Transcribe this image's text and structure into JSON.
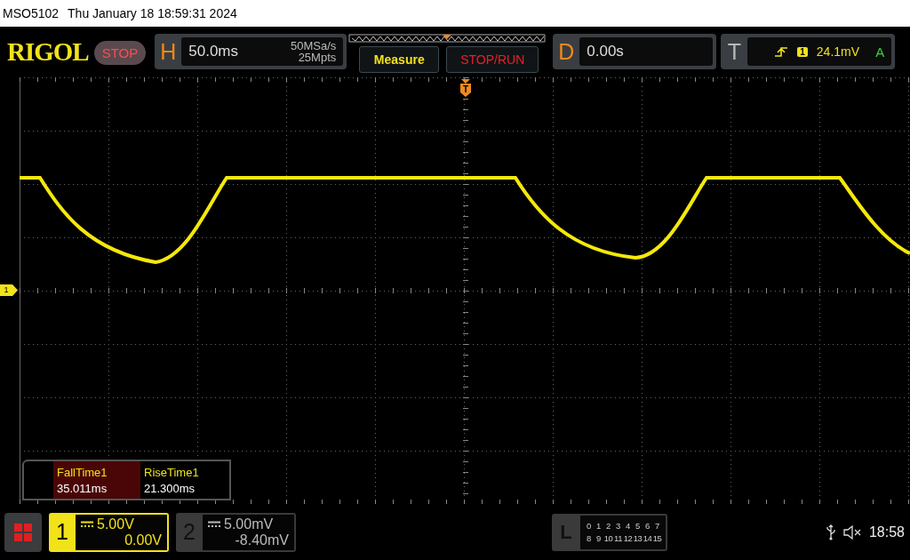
{
  "title_bar": {
    "model": "MSO5102",
    "datetime": "Thu January 18 18:59:31 2024"
  },
  "toolbar": {
    "logo": "RIGOL",
    "run_state": "STOP",
    "horizontal": {
      "label": "H",
      "timebase": "50.0ms",
      "sample_rate": "50MSa/s",
      "memory_depth": "25Mpts"
    },
    "buttons": [
      {
        "label": "Measure",
        "kind": "measure"
      },
      {
        "label": "STOP/RUN",
        "kind": "run"
      }
    ],
    "delay": {
      "label": "D",
      "value": "0.00s"
    },
    "trigger": {
      "label": "T",
      "source": "1",
      "level": "24.1mV",
      "mode": "A"
    }
  },
  "screen": {
    "trigger_marker": "T",
    "channel_marker": "1"
  },
  "measurements": [
    {
      "name": "FallTime1",
      "value": "35.011ms",
      "selected": true
    },
    {
      "name": "RiseTime1",
      "value": "21.300ms",
      "selected": false
    }
  ],
  "channels": [
    {
      "number": "1",
      "scale": "5.00V",
      "offset": "0.00V",
      "on": true
    },
    {
      "number": "2",
      "scale": "5.00mV",
      "offset": "-8.40mV",
      "on": false
    }
  ],
  "logic": {
    "label": "L",
    "rows": [
      [
        "0",
        "1",
        "2",
        "3",
        "4",
        "5",
        "6",
        "7"
      ],
      [
        "8",
        "9",
        "10",
        "11",
        "12",
        "13",
        "14",
        "15"
      ]
    ]
  },
  "status": {
    "time": "18:58"
  }
}
